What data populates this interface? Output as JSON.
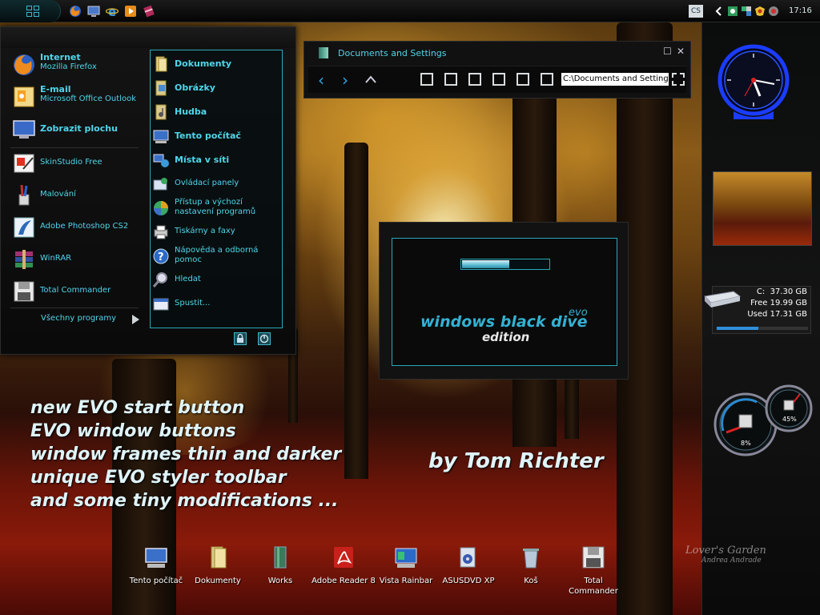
{
  "taskbar": {
    "clock": "17:16",
    "language": "CS",
    "quick_launch": [
      "firefox-icon",
      "show-desktop-icon",
      "ie-icon",
      "media-player-icon",
      "winrar-icon"
    ],
    "tray": [
      "arrow-left-icon",
      "network-icon",
      "display-icon",
      "security-icon",
      "gadget-icon"
    ]
  },
  "start_menu": {
    "pinned": [
      {
        "title": "Internet",
        "subtitle": "Mozilla Firefox",
        "icon": "firefox-icon"
      },
      {
        "title": "E-mail",
        "subtitle": "Microsoft Office Outlook",
        "icon": "outlook-icon"
      },
      {
        "title": "Zobrazit plochu",
        "icon": "show-desktop-icon"
      }
    ],
    "recent": [
      {
        "label": "SkinStudio Free",
        "icon": "skinstudio-icon"
      },
      {
        "label": "Malování",
        "icon": "paint-icon"
      },
      {
        "label": "Adobe Photoshop CS2",
        "icon": "photoshop-icon"
      },
      {
        "label": "WinRAR",
        "icon": "winrar-icon"
      },
      {
        "label": "Total Commander",
        "icon": "floppy-icon"
      }
    ],
    "all_programs": "Všechny programy",
    "right": [
      {
        "label": "Dokumenty",
        "bold": true,
        "icon": "folder-icon"
      },
      {
        "label": "Obrázky",
        "bold": true,
        "icon": "pictures-folder-icon"
      },
      {
        "label": "Hudba",
        "bold": true,
        "icon": "music-folder-icon"
      },
      {
        "label": "Tento počítač",
        "bold": true,
        "icon": "computer-icon"
      },
      {
        "label": "Místa v síti",
        "bold": true,
        "icon": "network-places-icon"
      },
      {
        "label": "Ovládací panely",
        "icon": "control-panel-icon"
      },
      {
        "label": "Přístup a výchozí",
        "label2": "nastavení programů",
        "icon": "default-programs-icon"
      },
      {
        "label": "Tiskárny a faxy",
        "icon": "printer-icon"
      },
      {
        "label": "Nápověda a odborná",
        "label2": "pomoc",
        "icon": "help-icon"
      },
      {
        "label": "Hledat",
        "icon": "search-icon"
      },
      {
        "label": "Spustit...",
        "icon": "run-icon"
      }
    ]
  },
  "explorer": {
    "title": "Documents and Settings",
    "address": "C:\\Documents and Settings"
  },
  "boot": {
    "brand": "windows black dive",
    "sup": "evo",
    "edition": "edition",
    "progress": 0.55
  },
  "features": [
    "new EVO start button",
    "EVO window buttons",
    "window frames thin and darker",
    "unique EVO styler toolbar",
    "and some tiny modifications ..."
  ],
  "author": "by Tom Richter",
  "desktop_icons": [
    {
      "label": "Tento počítač",
      "icon": "computer-icon"
    },
    {
      "label": "Dokumenty",
      "icon": "documents-folder-icon"
    },
    {
      "label": "Works",
      "icon": "works-icon"
    },
    {
      "label": "Adobe Reader 8",
      "icon": "adobe-reader-icon"
    },
    {
      "label": "Vista Rainbar",
      "icon": "rainbar-icon"
    },
    {
      "label": "ASUSDVD XP",
      "icon": "asusdvd-icon"
    },
    {
      "label": "Koš",
      "icon": "recycle-bin-icon"
    },
    {
      "label": "Total Commander",
      "icon": "floppy-icon"
    }
  ],
  "sidebar": {
    "drive_letter": "C:",
    "drive_total": "37.30 GB",
    "free_label": "Free",
    "free": "19.99 GB",
    "used_label": "Used",
    "used": "17.31 GB",
    "used_fraction": 0.46,
    "cpu_percent": "8%",
    "mem_percent": "45%"
  },
  "watermark": {
    "line1": "Lover's Garden",
    "line2": "Andrea Andrade"
  },
  "colors": {
    "accent": "#4fd6ea",
    "frame": "#2aa8b8",
    "clock_neon": "#2a54ff"
  }
}
